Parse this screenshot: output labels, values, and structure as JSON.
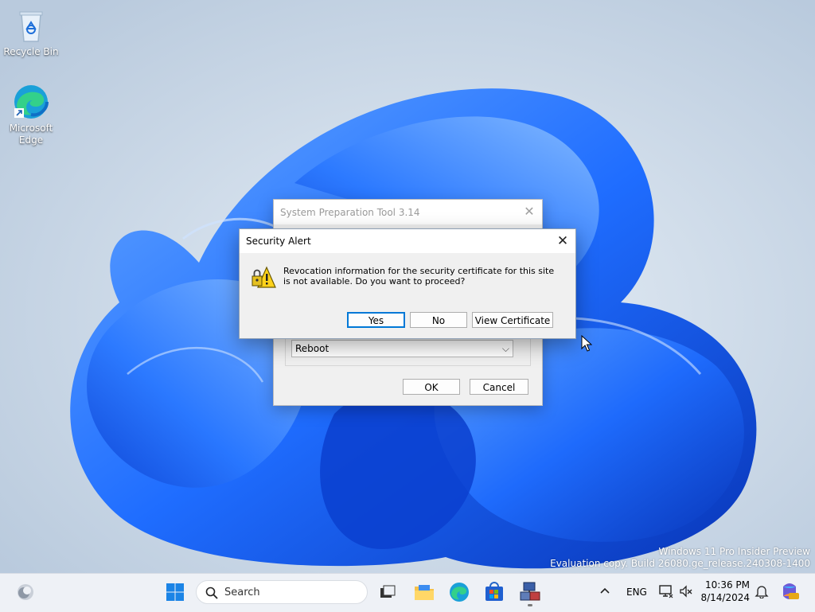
{
  "desktop": {
    "icons": [
      {
        "label": "Recycle Bin",
        "icon": "recycle-bin-icon"
      },
      {
        "label": "Microsoft Edge",
        "icon": "edge-icon"
      }
    ],
    "watermark": {
      "line1": "Windows 11 Pro Insider Preview",
      "line2": "Evaluation copy. Build 26080.ge_release.240308-1400"
    }
  },
  "sysprep": {
    "title": "System Preparation Tool 3.14",
    "shutdown_option": "Reboot",
    "ok_label": "OK",
    "cancel_label": "Cancel"
  },
  "alert": {
    "title": "Security Alert",
    "message": "Revocation information for the security certificate for this site is not available. Do you want to proceed?",
    "yes_label": "Yes",
    "no_label": "No",
    "view_cert_label": "View Certificate"
  },
  "taskbar": {
    "search_placeholder": "Search",
    "apps": [
      "task-view-icon",
      "file-explorer-icon",
      "edge-icon",
      "store-icon",
      "sysprep-app-icon"
    ],
    "language": "ENG",
    "time": "10:36 PM",
    "date": "8/14/2024"
  },
  "colors": {
    "accent": "#0078d7",
    "bloom_dark": "#0a3fd0",
    "bloom_light": "#3c8cff"
  }
}
